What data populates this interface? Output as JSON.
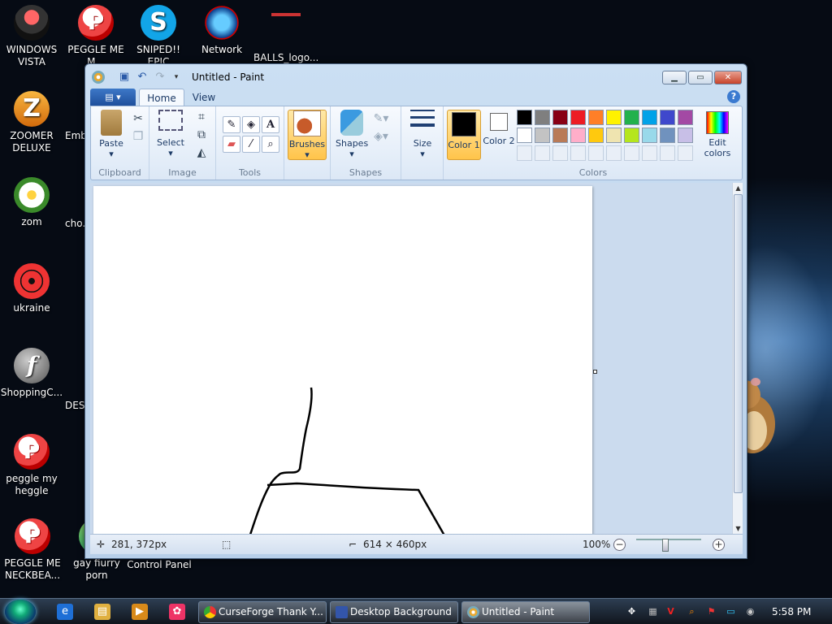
{
  "desktop": {
    "icons": [
      {
        "name": "WINDOWS VISTA"
      },
      {
        "name": "PEGGLE ME M..."
      },
      {
        "name": "SNIPED!! EPIC"
      },
      {
        "name": "Network"
      },
      {
        "name": "BALLS_logo..."
      },
      {
        "name": "ZOOMER DELUXE"
      },
      {
        "name": "Emb..."
      },
      {
        "name": "zom"
      },
      {
        "name": "cho..."
      },
      {
        "name": "ukraine"
      },
      {
        "name": "ShoppingC..."
      },
      {
        "name": "DES..."
      },
      {
        "name": "peggle my heggle"
      },
      {
        "name": "PEGGLE ME NECKBEA..."
      },
      {
        "name": "gay fiurry porn"
      },
      {
        "name": "Control Panel"
      }
    ]
  },
  "window": {
    "title": "Untitled - Paint",
    "controls": {
      "minimize": "▁",
      "maximize": "▭",
      "close": "✕"
    }
  },
  "ribbon": {
    "file_menu": "▤ ▾",
    "tabs": {
      "home": "Home",
      "view": "View"
    },
    "help": "?",
    "groups": {
      "clipboard": {
        "label": "Clipboard",
        "paste": "Paste"
      },
      "image": {
        "label": "Image",
        "select": "Select"
      },
      "tools": {
        "label": "Tools"
      },
      "brushes": "Brushes",
      "shapes": {
        "label": "Shapes",
        "shapes": "Shapes"
      },
      "size": "Size",
      "colors": {
        "label": "Colors",
        "color1": "Color 1",
        "color2": "Color 2",
        "edit": "Edit colors"
      }
    },
    "palette_row1": [
      "#000000",
      "#7f7f7f",
      "#880015",
      "#ed1c24",
      "#ff7f27",
      "#fff200",
      "#22b14c",
      "#00a2e8",
      "#3f48cc",
      "#a349a4"
    ],
    "palette_row2": [
      "#ffffff",
      "#c3c3c3",
      "#b97a57",
      "#ffaec9",
      "#ffc90e",
      "#efe4b0",
      "#b5e61d",
      "#99d9ea",
      "#7092be",
      "#c8bfe7"
    ],
    "color1": "#000000",
    "color2": "#ffffff"
  },
  "status": {
    "cursor_pos": "281, 372px",
    "canvas_size": "614 × 460px",
    "zoom": "100%"
  },
  "taskbar": {
    "tasks": [
      {
        "label": "CurseForge Thank Y..."
      },
      {
        "label": "Desktop Background"
      },
      {
        "label": "Untitled - Paint"
      }
    ],
    "clock": "5:58 PM"
  }
}
